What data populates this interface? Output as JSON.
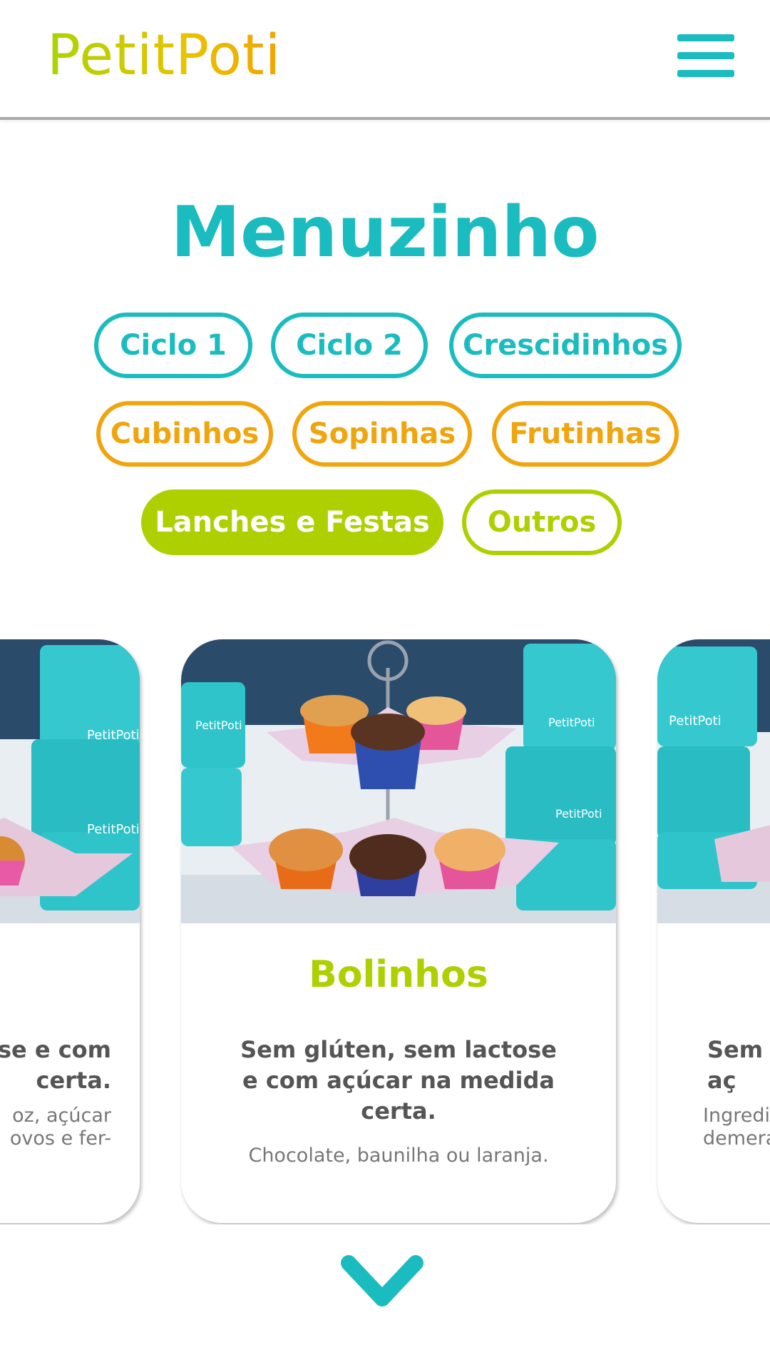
{
  "brand": {
    "logo_text": "PetitPoti"
  },
  "header": {
    "menu_icon": "hamburger-menu-icon"
  },
  "page": {
    "title": "Menuzinho"
  },
  "categories": [
    {
      "label": "Ciclo 1",
      "color": "#1bbcbf",
      "active": false
    },
    {
      "label": "Ciclo 2",
      "color": "#1bbcbf",
      "active": false
    },
    {
      "label": "Crescidinhos",
      "color": "#1bbcbf",
      "active": false
    },
    {
      "label": "Cubinhos",
      "color": "#f0a50e",
      "active": false
    },
    {
      "label": "Sopinhas",
      "color": "#f0a50e",
      "active": false
    },
    {
      "label": "Frutinhas",
      "color": "#f0a50e",
      "active": false
    },
    {
      "label": "Lanches e Festas",
      "color": "#aed000",
      "active": true
    },
    {
      "label": "Outros",
      "color": "#aed000",
      "active": false
    }
  ],
  "carousel": {
    "cards": [
      {
        "title": "",
        "subtitle": "se e com\ncerta.",
        "description": "oz, açúcar\novos e fer-"
      },
      {
        "title": "Bolinhos",
        "subtitle": "Sem glúten, sem lactose e com açúcar na medida certa.",
        "description": "Chocolate, baunilha ou laranja."
      },
      {
        "title": "",
        "subtitle": "Sem g\naç",
        "description": "Ingredi\ndemera"
      }
    ]
  },
  "scroll_indicator": {
    "icon": "chevron-down-icon"
  },
  "colors": {
    "teal": "#1bbcbf",
    "orange": "#f0a50e",
    "lime": "#aed000",
    "text": "#555555"
  }
}
